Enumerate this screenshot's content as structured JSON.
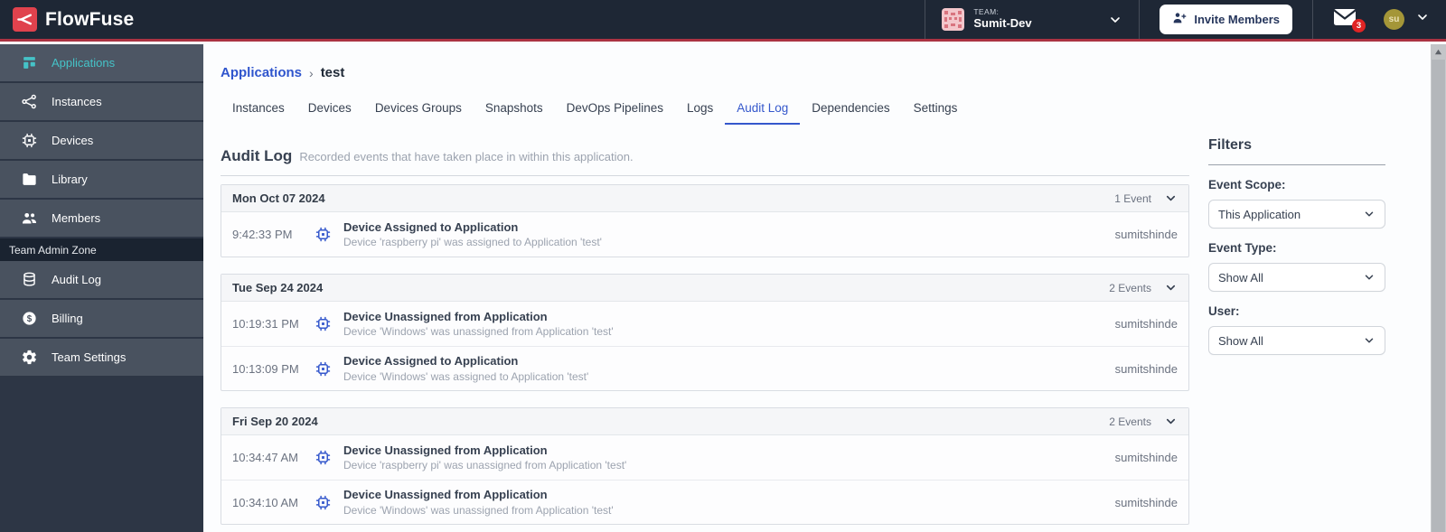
{
  "colors": {
    "navbar_bg": "#1e2735",
    "accent_red": "#ab3342",
    "brand_red": "#e0424d",
    "teal": "#45c3c8",
    "blue": "#3558cc",
    "badge_red": "#e02424"
  },
  "navbar": {
    "brand": "FlowFuse",
    "team_label": "TEAM:",
    "team_name": "Sumit-Dev",
    "invite_label": "Invite Members",
    "notification_count": "3",
    "avatar_initials": "su"
  },
  "sidebar": {
    "items": [
      {
        "label": "Applications",
        "icon": "applications-icon",
        "active": true
      },
      {
        "label": "Instances",
        "icon": "instances-icon",
        "active": false
      },
      {
        "label": "Devices",
        "icon": "devices-icon",
        "active": false
      },
      {
        "label": "Library",
        "icon": "library-icon",
        "active": false
      },
      {
        "label": "Members",
        "icon": "members-icon",
        "active": false
      }
    ],
    "admin_zone_label": "Team Admin Zone",
    "admin_items": [
      {
        "label": "Audit Log",
        "icon": "audit-log-icon",
        "active": false
      },
      {
        "label": "Billing",
        "icon": "billing-icon",
        "active": false
      },
      {
        "label": "Team Settings",
        "icon": "team-settings-icon",
        "active": false
      }
    ]
  },
  "breadcrumb": {
    "parent": "Applications",
    "separator": "›",
    "current": "test"
  },
  "tabs": [
    "Instances",
    "Devices",
    "Devices Groups",
    "Snapshots",
    "DevOps Pipelines",
    "Logs",
    "Audit Log",
    "Dependencies",
    "Settings"
  ],
  "active_tab": "Audit Log",
  "section": {
    "title": "Audit Log",
    "subtitle": "Recorded events that have taken place in within this application."
  },
  "audit_groups": [
    {
      "date": "Mon Oct 07 2024",
      "count": "1 Event",
      "events": [
        {
          "time": "9:42:33 PM",
          "icon": "device-chip-icon",
          "title": "Device Assigned to Application",
          "description": "Device 'raspberry pi' was assigned to Application 'test'",
          "user": "sumitshinde"
        }
      ]
    },
    {
      "date": "Tue Sep 24 2024",
      "count": "2 Events",
      "events": [
        {
          "time": "10:19:31 PM",
          "icon": "device-chip-icon",
          "title": "Device Unassigned from Application",
          "description": "Device 'Windows' was unassigned from Application 'test'",
          "user": "sumitshinde"
        },
        {
          "time": "10:13:09 PM",
          "icon": "device-chip-icon",
          "title": "Device Assigned to Application",
          "description": "Device 'Windows' was assigned to Application 'test'",
          "user": "sumitshinde"
        }
      ]
    },
    {
      "date": "Fri Sep 20 2024",
      "count": "2 Events",
      "events": [
        {
          "time": "10:34:47 AM",
          "icon": "device-chip-icon",
          "title": "Device Unassigned from Application",
          "description": "Device 'raspberry pi' was unassigned from Application 'test'",
          "user": "sumitshinde"
        },
        {
          "time": "10:34:10 AM",
          "icon": "device-chip-icon",
          "title": "Device Unassigned from Application",
          "description": "Device 'Windows' was unassigned from Application 'test'",
          "user": "sumitshinde"
        }
      ]
    }
  ],
  "filters": {
    "title": "Filters",
    "fields": [
      {
        "label": "Event Scope:",
        "value": "This Application"
      },
      {
        "label": "Event Type:",
        "value": "Show All"
      },
      {
        "label": "User:",
        "value": "Show All"
      }
    ]
  }
}
